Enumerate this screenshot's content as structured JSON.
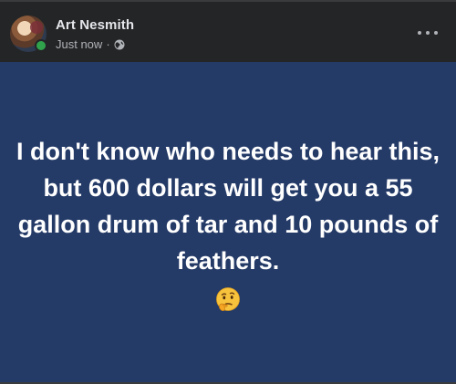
{
  "post": {
    "author": {
      "name": "Art Nesmith",
      "online": true
    },
    "timestamp": "Just now",
    "separator": "·",
    "privacy_icon": "globe-icon",
    "more_icon": "more-options-icon",
    "body": {
      "text": "I don't know who needs to hear this, but 600 dollars will get you a 55 gallon drum of tar and 10 pounds of feathers.",
      "emoji": "thinking-face-icon",
      "background_color": "#243a67",
      "text_color": "#ffffff"
    }
  }
}
